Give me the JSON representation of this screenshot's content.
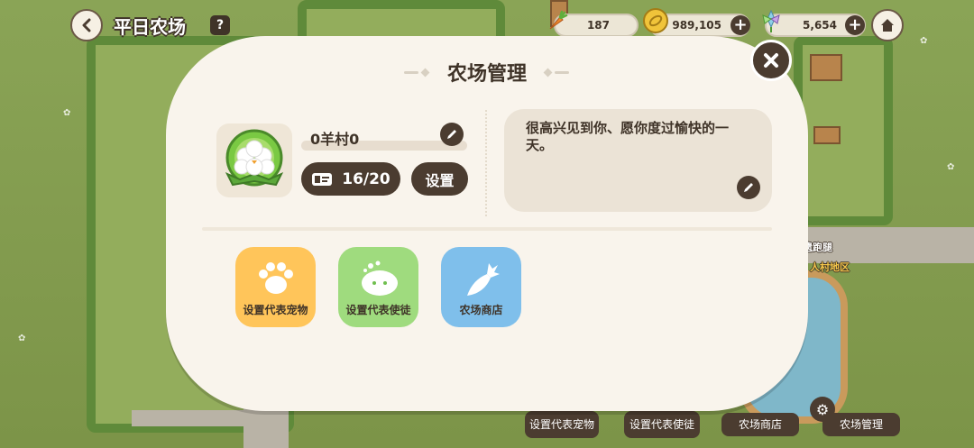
{
  "topbar": {
    "farm_title": "平日农场",
    "help_symbol": "?",
    "resources": [
      {
        "icon": "carrot-icon",
        "value": "187"
      },
      {
        "icon": "coin-icon",
        "value": "989,105"
      },
      {
        "icon": "crystal-flower-icon",
        "value": "5,654"
      }
    ],
    "plus_symbol": "+"
  },
  "modal": {
    "title": "农场管理",
    "farm_name": "0羊村0",
    "visitor_count": "16/20",
    "settings_label": "设置",
    "greeting": "很高兴见到你、愿你度过愉快的一天。",
    "functions": [
      {
        "label": "设置代表宠物",
        "icon": "paw-icon",
        "color": "#ffc55a"
      },
      {
        "label": "设置代表使徒",
        "icon": "spirit-icon",
        "color": "#9fdb7e"
      },
      {
        "label": "农场商店",
        "icon": "radish-icon",
        "color": "#7fbfeb"
      }
    ]
  },
  "bottombar": {
    "tabs": [
      "设置代表宠物",
      "设置代表使徒",
      "农场商店",
      "农场管理"
    ]
  },
  "map_labels": {
    "route": "遗跑腿",
    "district": "人村地区"
  },
  "colors": {
    "modal_bg": "#f9f4ec",
    "dark_brown": "#4b3c30",
    "text": "#3f3328"
  }
}
